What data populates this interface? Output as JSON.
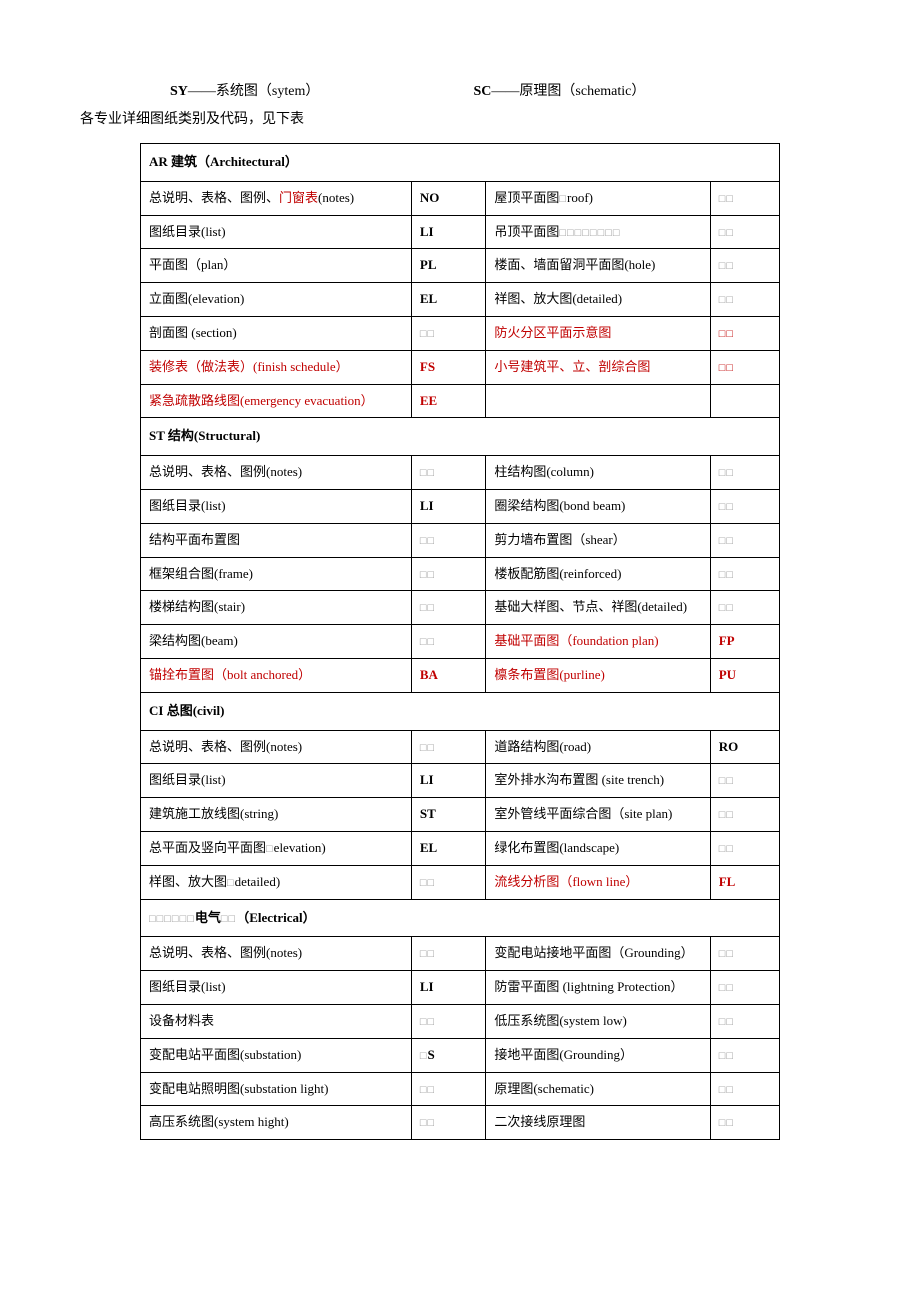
{
  "header": {
    "sy_code": "SY",
    "sy_dash": "——",
    "sy_text": "系统图（sytem）",
    "sc_code": "SC",
    "sc_dash": "——",
    "sc_text": "原理图（schematic）"
  },
  "subheader": "各专业详细图纸类别及代码，见下表",
  "sections": [
    {
      "title": "AR 建筑（Architectural）",
      "rows": [
        {
          "c1": "总说明、表格、图例、",
          "c1_red": "门窗表",
          "c1_suffix": "(notes)",
          "c2": "NO",
          "c3": "屋顶平面图",
          "c3_ph": "□",
          "c3_suffix": "roof)",
          "c4_ph": "□□"
        },
        {
          "c1": "图纸目录(list)",
          "c2": "LI",
          "c3": "吊顶平面图",
          "c3_ph": "□□□□□□□□",
          "c4_ph": "□□"
        },
        {
          "c1": "平面图（plan）",
          "c2": "PL",
          "c3": "楼面、墙面留洞平面图(hole)",
          "c4_ph": "□□"
        },
        {
          "c1": "立面图(elevation)",
          "c2": "EL",
          "c3": "祥图、放大图(detailed)",
          "c4_ph": "□□"
        },
        {
          "c1": "剖面图 (section)",
          "c2_ph": "□□",
          "c3_red": "防火分区平面示意图",
          "c4_ph_red": "□□"
        },
        {
          "c1_red": "装修表（做法表）(finish schedule）",
          "c2_red": "FS",
          "c3_red": "小号建筑平、立、剖综合图",
          "c4_ph_red": "□□"
        },
        {
          "c1_red": "紧急疏散路线图(emergency evacuation）",
          "c2_red": "EE",
          "c3": "",
          "c4": ""
        }
      ]
    },
    {
      "title": "ST 结构(Structural)",
      "rows": [
        {
          "c1": "总说明、表格、图例(notes)",
          "c2_ph": "□□",
          "c3": "柱结构图(column)",
          "c4_ph": "□□"
        },
        {
          "c1": "图纸目录(list)",
          "c2": "LI",
          "c3": "圈梁结构图(bond beam)",
          "c4_ph": "□□"
        },
        {
          "c1": "结构平面布置图",
          "c2_ph": "□□",
          "c3": "剪力墙布置图（shear）",
          "c4_ph": "□□"
        },
        {
          "c1": "框架组合图(frame)",
          "c2_ph": "□□",
          "c3": "楼板配筋图(reinforced)",
          "c4_ph": "□□"
        },
        {
          "c1": "楼梯结构图(stair)",
          "c2_ph": "□□",
          "c3": "基础大样图、节点、祥图(detailed)",
          "c4_ph": "□□"
        },
        {
          "c1": "梁结构图(beam)",
          "c2_ph": "□□",
          "c3_red": "基础平面图（foundation plan)",
          "c4_red": "FP"
        },
        {
          "c1_red": "锚拴布置图（bolt anchored）",
          "c2_red": "BA",
          "c3_red": "檩条布置图(purline)",
          "c4_red": "PU"
        }
      ]
    },
    {
      "title": "CI 总图(civil)",
      "rows": [
        {
          "c1": "总说明、表格、图例(notes)",
          "c2_ph": "□□",
          "c3": "道路结构图(road)",
          "c4": "RO"
        },
        {
          "c1": "图纸目录(list)",
          "c2": "LI",
          "c3": "室外排水沟布置图 (site trench)",
          "c4_ph": "□□"
        },
        {
          "c1": "建筑施工放线图(string)",
          "c2": "ST",
          "c3": "室外管线平面综合图（site plan)",
          "c4_ph": "□□"
        },
        {
          "c1": "总平面及竖向平面图",
          "c1_ph": "□",
          "c1_suffix": "elevation)",
          "c2": "EL",
          "c3": "绿化布置图(landscape)",
          "c4_ph": "□□"
        },
        {
          "c1": "样图、放大图",
          "c1_ph": "□",
          "c1_suffix": "detailed)",
          "c2_ph": "□□",
          "c3_red": "流线分析图（flown line）",
          "c4_red": "FL"
        }
      ]
    },
    {
      "title_ph": "□□□□□□",
      "title_bold": "电气",
      "title_ph2": "□□",
      "title_suffix": "（Electrical）",
      "rows": [
        {
          "c1": "总说明、表格、图例(notes)",
          "c2_ph": "□□",
          "c3": "变配电站接地平面图（Grounding）",
          "c4_ph": "□□"
        },
        {
          "c1": "图纸目录(list)",
          "c2": "LI",
          "c3": "防雷平面图 (lightning Protection）",
          "c4_ph": "□□"
        },
        {
          "c1": "设备材料表",
          "c2_ph": "□□",
          "c3": "低压系统图(system low)",
          "c4_ph": "□□"
        },
        {
          "c1": "变配电站平面图(substation)",
          "c2_ph": "□",
          "c2_suffix": "S",
          "c3": "接地平面图(Grounding）",
          "c4_ph": "□□"
        },
        {
          "c1": "变配电站照明图(substation light)",
          "c2_ph": "□□",
          "c3": "原理图(schematic)",
          "c4_ph": "□□"
        },
        {
          "c1": "高压系统图(system hight)",
          "c2_ph": "□□",
          "c3": "二次接线原理图",
          "c4_ph": "□□"
        }
      ]
    }
  ]
}
